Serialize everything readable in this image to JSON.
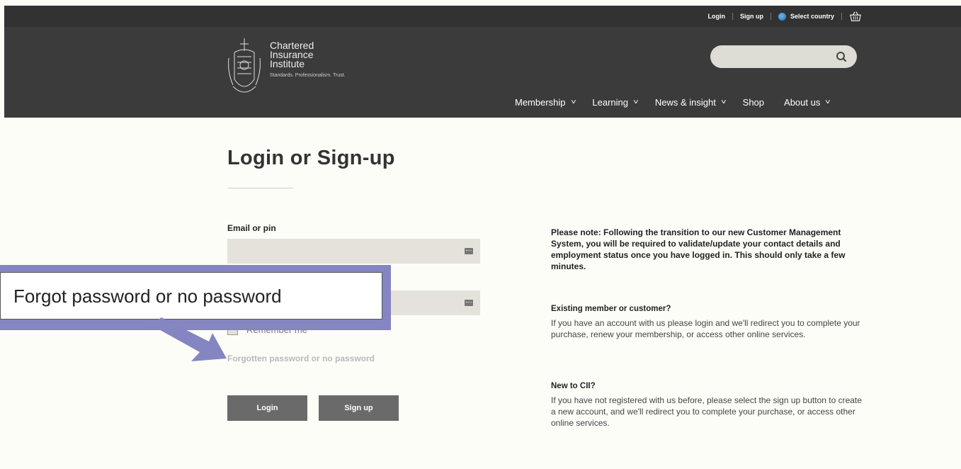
{
  "utility": {
    "login": "Login",
    "signup": "Sign up",
    "select_country": "Select country"
  },
  "logo": {
    "line1": "Chartered",
    "line2": "Insurance",
    "line3": "Institute",
    "tagline": "Standards. Professionalism. Trust."
  },
  "search": {
    "placeholder": ""
  },
  "nav": {
    "items": [
      {
        "label": "Membership"
      },
      {
        "label": "Learning"
      },
      {
        "label": "News & insight"
      },
      {
        "label": "Shop"
      },
      {
        "label": "About us"
      }
    ]
  },
  "main": {
    "title": "Login or Sign-up",
    "email_label": "Email or pin",
    "remember_label": "Remember me",
    "forgot_link": "Forgotten password or no password",
    "login_button": "Login",
    "signup_button": "Sign up"
  },
  "info": {
    "notice": "Please note: Following the transition to our new Customer Management System, you will be required to validate/update your contact details and employment status once you have logged in. This should only take a few minutes.",
    "existing_title": "Existing member or customer?",
    "existing_body": "If you have an account with us please login and we'll redirect you to complete your purchase, renew your membership, or access other online services.",
    "new_title": "New to CII?",
    "new_body": "If you have not registered with us before, please select the sign up button to create a new account, and we'll redirect you to complete your purchase, or access other online services."
  },
  "callout": {
    "text": "Forgot password or no password",
    "color": "#8585c2"
  },
  "colors": {
    "header": "#3b3b3b",
    "button": "#6a6a6a",
    "background": "#fdfdf8"
  }
}
